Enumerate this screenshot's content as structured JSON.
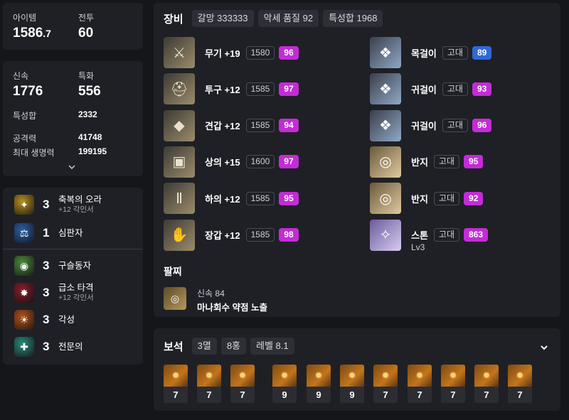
{
  "stats_top": {
    "item_label": "아이템",
    "item_value": "1586",
    "item_decimal": ".7",
    "combat_label": "전투",
    "combat_value": "60"
  },
  "stats_main": {
    "swift_label": "신속",
    "swift_value": "1776",
    "spec_label": "특화",
    "spec_value": "556",
    "total_label": "특성합",
    "total_value": "2332",
    "atk_label": "공격력",
    "atk_value": "41748",
    "hp_label": "최대 생명력",
    "hp_value": "199195",
    "expand_icon": "chevron-down-icon"
  },
  "engravings": [
    {
      "level": "3",
      "name": "축복의 오라",
      "sub": "+12 각인서",
      "color": "#b8901e",
      "glyph": "✦"
    },
    {
      "level": "1",
      "name": "심판자",
      "sub": "",
      "color": "#2a5fa8",
      "glyph": "⚖"
    },
    {
      "level": "3",
      "name": "구슬동자",
      "sub": "",
      "color": "#4c8a3a",
      "glyph": "◉"
    },
    {
      "level": "3",
      "name": "급소 타격",
      "sub": "+12 각인서",
      "color": "#8a1c2c",
      "glyph": "✸"
    },
    {
      "level": "3",
      "name": "각성",
      "sub": "",
      "color": "#b5521a",
      "glyph": "☀"
    },
    {
      "level": "3",
      "name": "전문의",
      "sub": "",
      "color": "#2b8a7c",
      "glyph": "✚"
    }
  ],
  "equipment": {
    "title": "장비",
    "chips": [
      "갈망 333333",
      "악세 품질 92",
      "특성합 1968"
    ],
    "left": [
      {
        "name": "무기 +19",
        "ilvl": "1580",
        "quality": "96",
        "glyph": "⚔"
      },
      {
        "name": "투구 +12",
        "ilvl": "1585",
        "quality": "97",
        "glyph": "⛑"
      },
      {
        "name": "견갑 +12",
        "ilvl": "1585",
        "quality": "94",
        "glyph": "◆"
      },
      {
        "name": "상의 +15",
        "ilvl": "1600",
        "quality": "97",
        "glyph": "▣"
      },
      {
        "name": "하의 +12",
        "ilvl": "1585",
        "quality": "95",
        "glyph": "Ⅱ"
      },
      {
        "name": "장갑 +12",
        "ilvl": "1585",
        "quality": "98",
        "glyph": "✋"
      }
    ],
    "right": [
      {
        "name": "목걸이",
        "grade": "고대",
        "quality": "89",
        "badge": "blue",
        "glyph": "❖"
      },
      {
        "name": "귀걸이",
        "grade": "고대",
        "quality": "93",
        "badge": "pink",
        "glyph": "❖"
      },
      {
        "name": "귀걸이",
        "grade": "고대",
        "quality": "96",
        "badge": "pink",
        "glyph": "❖"
      },
      {
        "name": "반지",
        "grade": "고대",
        "quality": "95",
        "badge": "pink",
        "glyph": "◎"
      },
      {
        "name": "반지",
        "grade": "고대",
        "quality": "92",
        "badge": "pink",
        "glyph": "◎"
      },
      {
        "name": "스톤",
        "grade": "고대",
        "quality": "863",
        "badge": "pink",
        "glyph": "✧",
        "extra": "Lv3"
      }
    ],
    "bracelet_title": "팔찌",
    "bracelet_line1": "신속 84",
    "bracelet_line2": "마나회수  약점 노출"
  },
  "gems": {
    "title": "보석",
    "chips": [
      "3멸",
      "8홍",
      "레벨 8.1"
    ],
    "levels": [
      "7",
      "7",
      "7",
      "9",
      "9",
      "9",
      "7",
      "7",
      "7",
      "7",
      "7"
    ],
    "collapse_icon": "chevron-down-icon"
  }
}
